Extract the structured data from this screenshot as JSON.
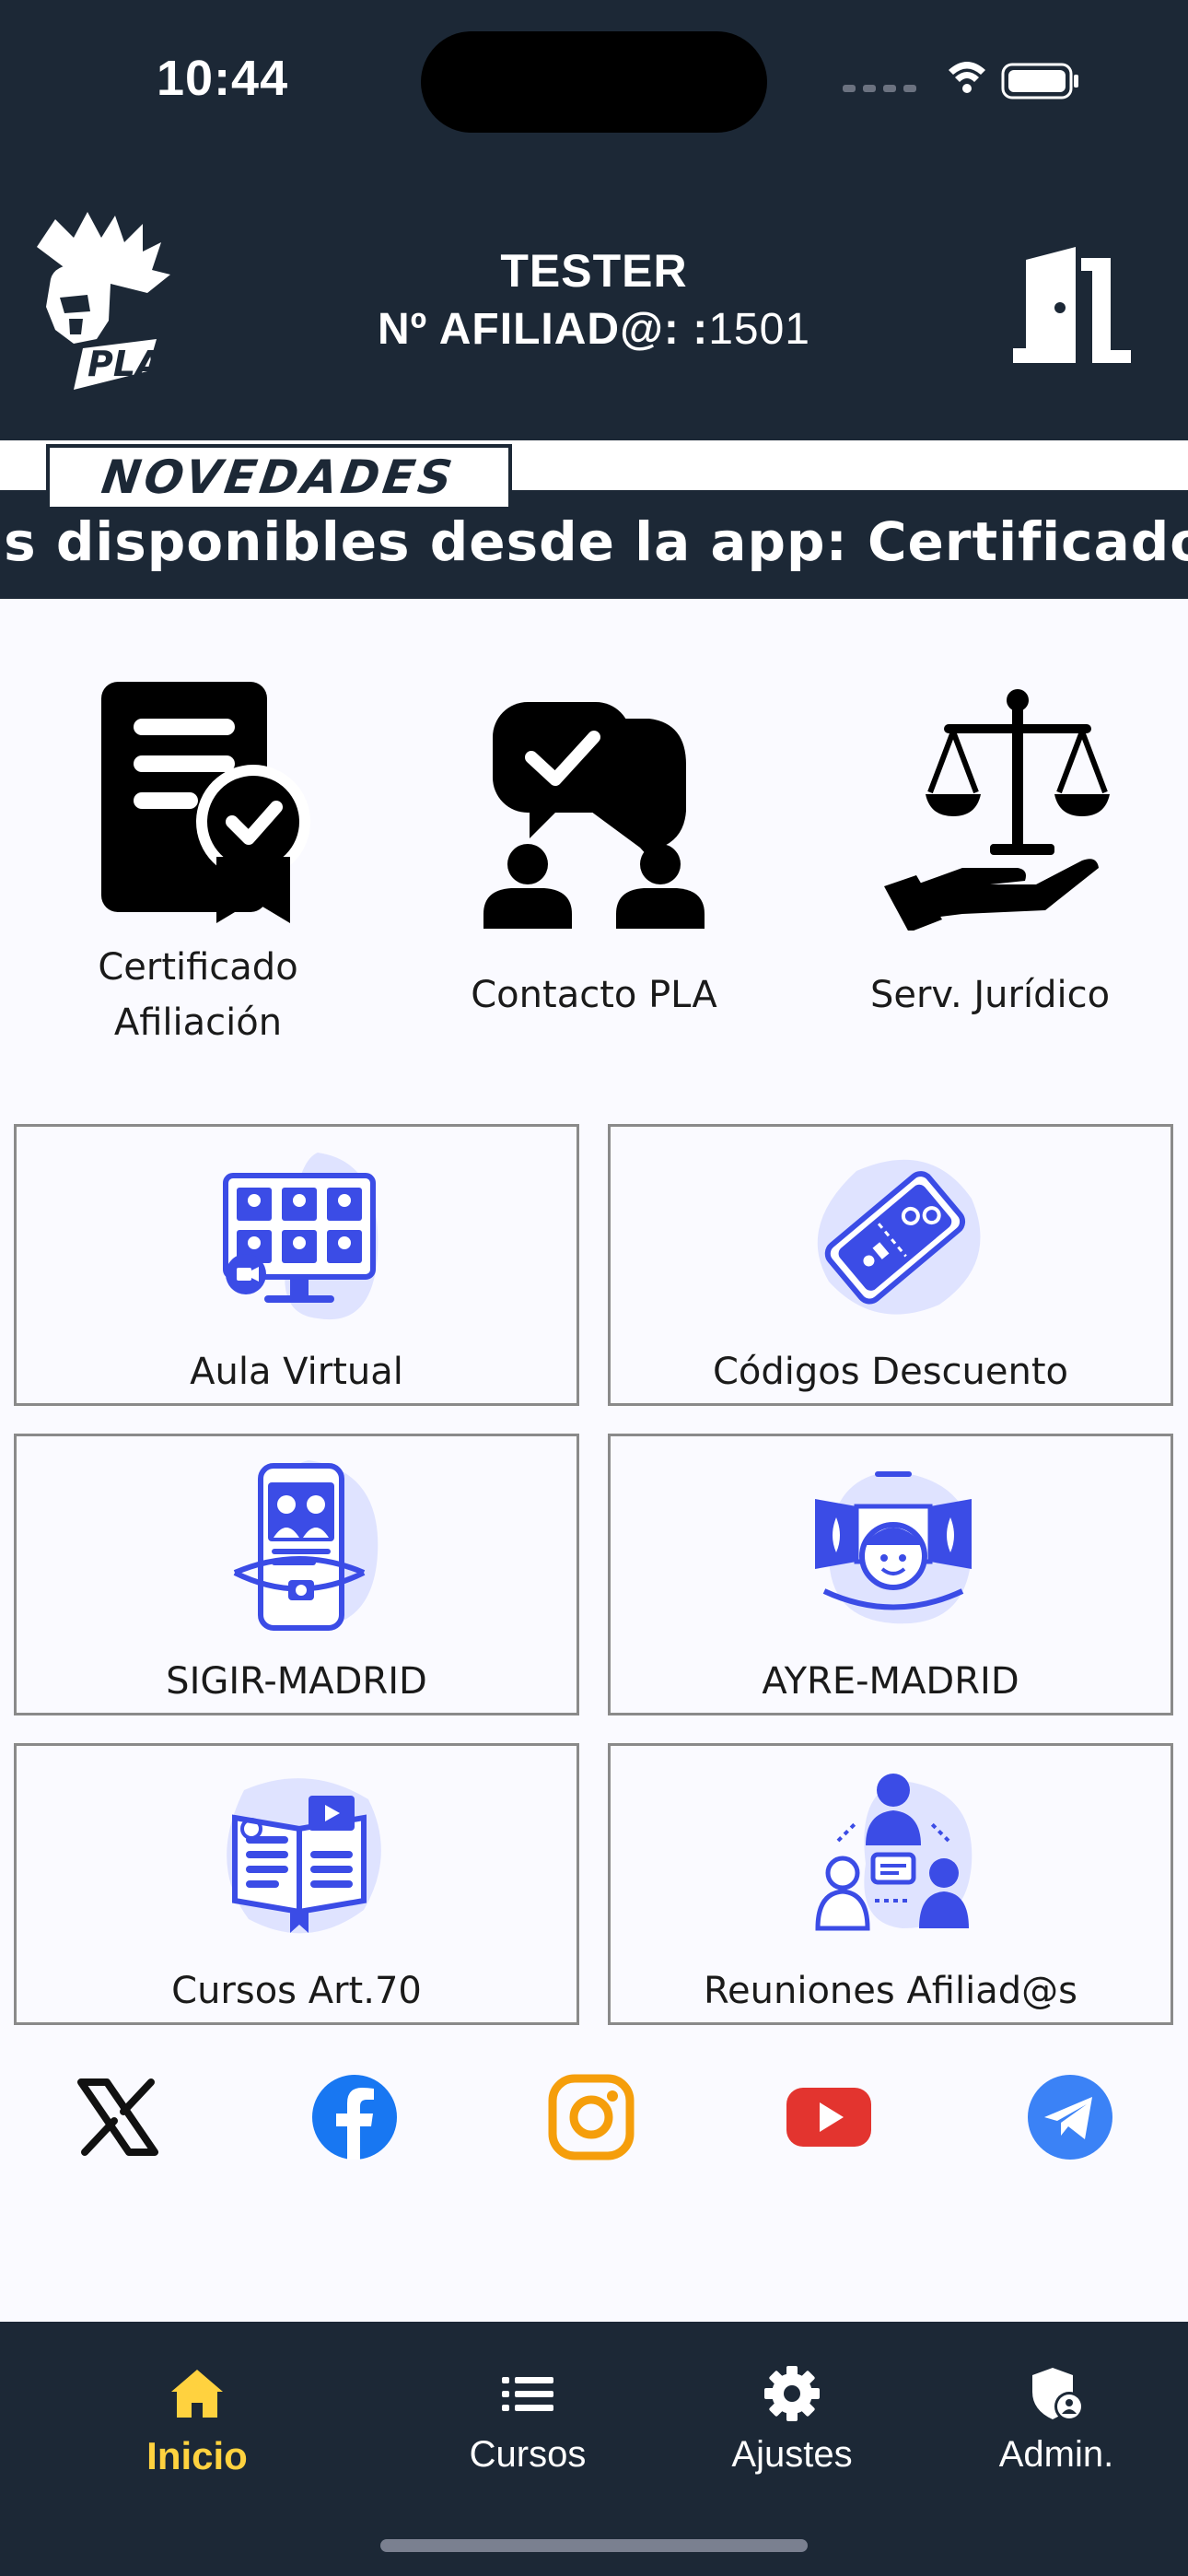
{
  "status_bar": {
    "time": "10:44"
  },
  "header": {
    "user_name": "TESTER",
    "afiliado_label": "Nº AFILIAD@: :",
    "afiliado_number": "1501",
    "logo_text": "PLA",
    "logo_icon": "spartan-helmet-icon",
    "exit_icon": "door-exit-icon"
  },
  "news": {
    "tab_label": "NOVEDADES",
    "ticker_text": "as disponibles desde la app:  Certificado"
  },
  "quick_actions": [
    {
      "label_line1": "Certificado",
      "label_line2": "Afiliación",
      "icon": "certificate-icon"
    },
    {
      "label_line1": "Contacto PLA",
      "label_line2": "",
      "icon": "contact-chat-icon"
    },
    {
      "label_line1": "Serv. Jurídico",
      "label_line2": "",
      "icon": "legal-scales-icon"
    }
  ],
  "cards": [
    {
      "label": "Aula Virtual",
      "icon": "virtual-classroom-icon"
    },
    {
      "label": "Códigos Descuento",
      "icon": "discount-ticket-icon"
    },
    {
      "label": "SIGIR-MADRID",
      "icon": "mobile-app-icon"
    },
    {
      "label": "AYRE-MADRID",
      "icon": "vr-user-icon"
    },
    {
      "label": "Cursos Art.70",
      "icon": "open-book-icon"
    },
    {
      "label": "Reuniones Afiliad@s",
      "icon": "meeting-group-icon"
    }
  ],
  "social": [
    {
      "name": "X",
      "icon": "x-icon",
      "color": "#111111"
    },
    {
      "name": "Facebook",
      "icon": "facebook-icon",
      "color": "#1877f2"
    },
    {
      "name": "Instagram",
      "icon": "instagram-icon",
      "color": "#f59e0b"
    },
    {
      "name": "YouTube",
      "icon": "youtube-icon",
      "color": "#e3342f"
    },
    {
      "name": "Telegram",
      "icon": "telegram-icon",
      "color": "#3b82f6"
    }
  ],
  "bottom_nav": [
    {
      "label": "Inicio",
      "icon": "home-icon",
      "active": true
    },
    {
      "label": "Cursos",
      "icon": "list-icon",
      "active": false
    },
    {
      "label": "Ajustes",
      "icon": "gear-icon",
      "active": false
    },
    {
      "label": "Admin.",
      "icon": "admin-shield-icon",
      "active": false
    }
  ],
  "colors": {
    "header_bg": "#1c2836",
    "active_nav": "#ffd23f",
    "illustration_blue": "#3b4ce6"
  }
}
